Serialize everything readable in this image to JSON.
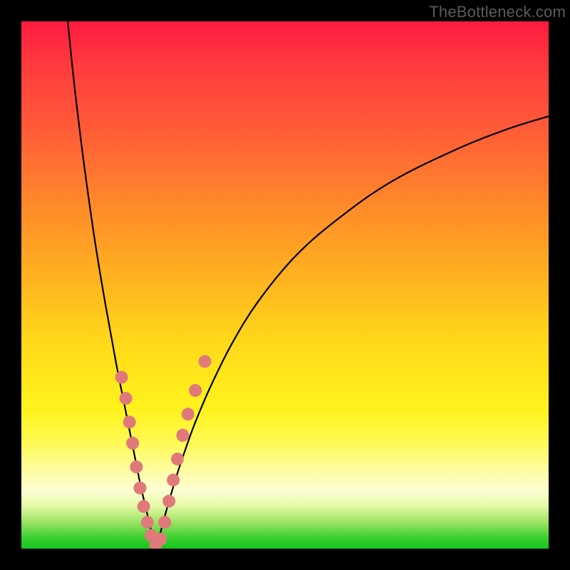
{
  "watermark": "TheBottleneck.com",
  "colors": {
    "curve_stroke": "#000000",
    "marker_fill": "#e07a7a",
    "marker_stroke": "#d86a6a"
  },
  "chart_data": {
    "type": "line",
    "title": "",
    "xlabel": "",
    "ylabel": "",
    "xlim": [
      0,
      100
    ],
    "ylim": [
      0,
      100
    ],
    "notch_x": 25.5,
    "series": [
      {
        "name": "left_branch",
        "x": [
          8.8,
          9.5,
          10.5,
          12.0,
          14.0,
          16.0,
          18.0,
          19.5,
          20.7,
          21.7,
          22.5,
          23.3,
          24.0,
          24.6,
          25.1,
          25.5
        ],
        "y": [
          100.0,
          93.0,
          84.0,
          72.0,
          58.0,
          46.0,
          35.0,
          27.5,
          21.5,
          16.5,
          12.5,
          9.0,
          6.0,
          3.5,
          1.5,
          0.4
        ]
      },
      {
        "name": "right_branch",
        "x": [
          25.5,
          25.9,
          26.5,
          27.3,
          28.3,
          29.5,
          31.0,
          33.0,
          36.0,
          40.0,
          45.0,
          52.0,
          60.0,
          70.0,
          82.0,
          92.0,
          100.0
        ],
        "y": [
          0.4,
          1.5,
          3.5,
          6.5,
          10.0,
          14.0,
          18.5,
          24.0,
          31.0,
          39.0,
          47.0,
          55.5,
          62.5,
          69.5,
          75.5,
          79.5,
          82.0
        ]
      }
    ],
    "markers": [
      {
        "name": "left_cluster",
        "x": 19.0,
        "y": 32.5
      },
      {
        "name": "left_cluster",
        "x": 19.8,
        "y": 28.5
      },
      {
        "name": "left_cluster",
        "x": 20.5,
        "y": 24.0
      },
      {
        "name": "left_cluster",
        "x": 21.1,
        "y": 20.0
      },
      {
        "name": "left_cluster",
        "x": 21.8,
        "y": 15.5
      },
      {
        "name": "left_cluster",
        "x": 22.5,
        "y": 11.5
      },
      {
        "name": "left_cluster",
        "x": 23.2,
        "y": 8.0
      },
      {
        "name": "left_cluster",
        "x": 23.9,
        "y": 5.0
      },
      {
        "name": "left_cluster",
        "x": 24.6,
        "y": 2.5
      },
      {
        "name": "bottom",
        "x": 25.5,
        "y": 0.8
      },
      {
        "name": "bottom",
        "x": 26.4,
        "y": 1.8
      },
      {
        "name": "right_cluster",
        "x": 27.2,
        "y": 5.0
      },
      {
        "name": "right_cluster",
        "x": 28.0,
        "y": 9.0
      },
      {
        "name": "right_cluster",
        "x": 28.8,
        "y": 13.0
      },
      {
        "name": "right_cluster",
        "x": 29.6,
        "y": 17.0
      },
      {
        "name": "right_cluster",
        "x": 30.6,
        "y": 21.5
      },
      {
        "name": "right_cluster",
        "x": 31.6,
        "y": 25.5
      },
      {
        "name": "right_cluster",
        "x": 33.0,
        "y": 30.0
      },
      {
        "name": "right_cluster",
        "x": 34.8,
        "y": 35.5
      }
    ]
  }
}
